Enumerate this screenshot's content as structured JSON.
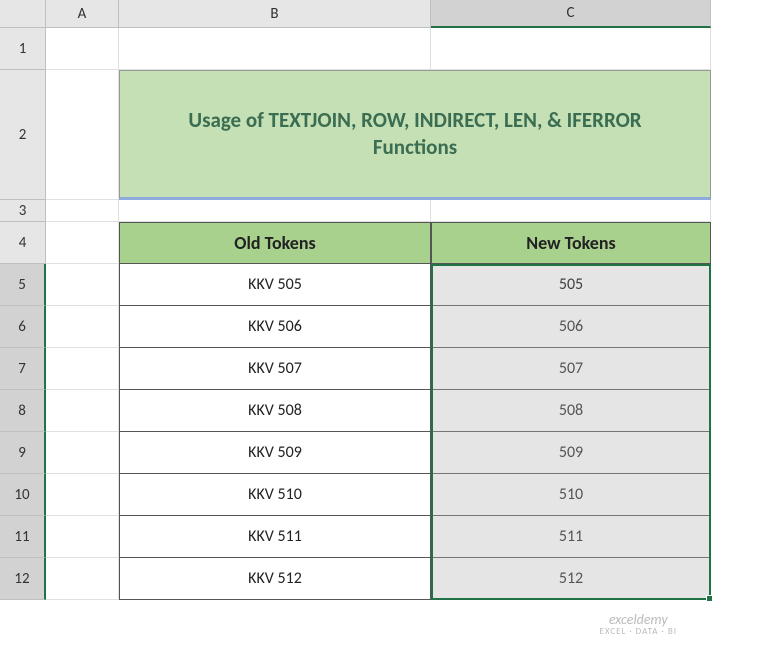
{
  "columns": [
    "A",
    "B",
    "C"
  ],
  "rows": [
    "1",
    "2",
    "3",
    "4",
    "5",
    "6",
    "7",
    "8",
    "9",
    "10",
    "11",
    "12"
  ],
  "title": "Usage of  TEXTJOIN, ROW, INDIRECT, LEN, & IFERROR Functions",
  "headers": {
    "old": "Old Tokens",
    "new": "New Tokens"
  },
  "chart_data": {
    "type": "table",
    "columns": [
      "Old Tokens",
      "New Tokens"
    ],
    "rows": [
      [
        "KKV 505",
        "505"
      ],
      [
        "KKV 506",
        "506"
      ],
      [
        "KKV 507",
        "507"
      ],
      [
        "KKV 508",
        "508"
      ],
      [
        "KKV 509",
        "509"
      ],
      [
        "KKV 510",
        "510"
      ],
      [
        "KKV 511",
        "511"
      ],
      [
        "KKV 512",
        "512"
      ]
    ]
  },
  "watermark": {
    "main": "exceldemy",
    "sub": "EXCEL · DATA · BI"
  }
}
